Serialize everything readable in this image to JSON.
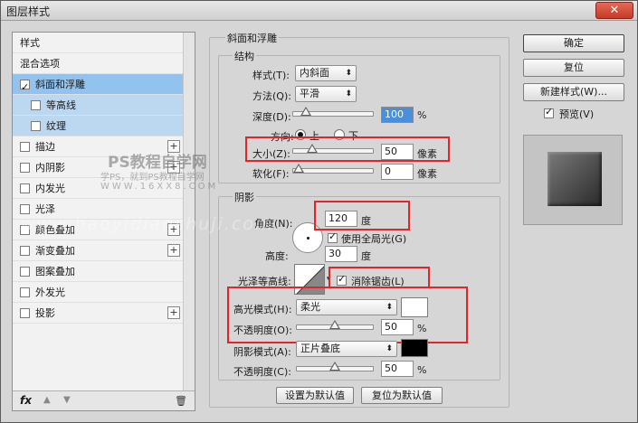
{
  "window": {
    "title": "图层样式",
    "close_glyph": "✕"
  },
  "left_panel": {
    "items": [
      {
        "label": "样式",
        "checkbox": false,
        "checked": false,
        "plus": false,
        "state": "normal"
      },
      {
        "label": "混合选项",
        "checkbox": false,
        "checked": false,
        "plus": false,
        "state": "normal"
      },
      {
        "label": "斜面和浮雕",
        "checkbox": true,
        "checked": true,
        "plus": false,
        "state": "selected"
      },
      {
        "label": "等高线",
        "checkbox": true,
        "checked": false,
        "plus": false,
        "state": "sub"
      },
      {
        "label": "纹理",
        "checkbox": true,
        "checked": false,
        "plus": false,
        "state": "sub"
      },
      {
        "label": "描边",
        "checkbox": true,
        "checked": false,
        "plus": true,
        "state": "normal"
      },
      {
        "label": "内阴影",
        "checkbox": true,
        "checked": false,
        "plus": true,
        "state": "normal"
      },
      {
        "label": "内发光",
        "checkbox": true,
        "checked": false,
        "plus": false,
        "state": "normal"
      },
      {
        "label": "光泽",
        "checkbox": true,
        "checked": false,
        "plus": false,
        "state": "normal"
      },
      {
        "label": "颜色叠加",
        "checkbox": true,
        "checked": false,
        "plus": true,
        "state": "normal"
      },
      {
        "label": "渐变叠加",
        "checkbox": true,
        "checked": false,
        "plus": true,
        "state": "normal"
      },
      {
        "label": "图案叠加",
        "checkbox": true,
        "checked": false,
        "plus": false,
        "state": "normal"
      },
      {
        "label": "外发光",
        "checkbox": true,
        "checked": false,
        "plus": false,
        "state": "normal"
      },
      {
        "label": "投影",
        "checkbox": true,
        "checked": false,
        "plus": true,
        "state": "normal"
      }
    ],
    "footer": {
      "fx": "fx",
      "up": "▲",
      "down": "▼",
      "trash": "🗑"
    }
  },
  "bevel": {
    "section_title": "斜面和浮雕",
    "structure_title": "结构",
    "style_label": "样式(T):",
    "style_value": "内斜面",
    "technique_label": "方法(Q):",
    "technique_value": "平滑",
    "depth_label": "深度(D):",
    "depth_value": "100",
    "depth_unit": "%",
    "depth_level": 0.1,
    "direction_label": "方向:",
    "direction_up": "上",
    "direction_down": "下",
    "size_label": "大小(Z):",
    "size_value": "50",
    "size_unit": "像素",
    "size_level": 0.2,
    "soften_label": "软化(F):",
    "soften_value": "0",
    "soften_unit": "像素",
    "soften_level": 0
  },
  "shading": {
    "title": "阴影",
    "angle_label": "角度(N):",
    "angle_value": "120",
    "angle_unit": "度",
    "global_light_label": "使用全局光(G)",
    "global_light_checked": true,
    "altitude_label": "高度:",
    "altitude_value": "30",
    "altitude_unit": "度",
    "gloss_contour_label": "光泽等高线:",
    "anti_alias_label": "消除锯齿(L)",
    "anti_alias_checked": true,
    "highlight_mode_label": "高光模式(H):",
    "highlight_mode_value": "柔光",
    "highlight_color": "#ffffff",
    "highlight_opacity_label": "不透明度(O):",
    "highlight_opacity_value": "50",
    "highlight_opacity_unit": "%",
    "highlight_opacity_level": 0.5,
    "shadow_mode_label": "阴影模式(A):",
    "shadow_mode_value": "正片叠底",
    "shadow_color": "#000000",
    "shadow_opacity_label": "不透明度(C):",
    "shadow_opacity_value": "50",
    "shadow_opacity_unit": "%",
    "shadow_opacity_level": 0.5
  },
  "bottom_buttons": {
    "make_default": "设置为默认值",
    "reset_default": "复位为默认值"
  },
  "right_panel": {
    "ok": "确定",
    "reset": "复位",
    "new_style": "新建样式(W)...",
    "preview_label": "预览(V)",
    "preview_checked": true
  },
  "watermark": {
    "line1": "PS教程自学网",
    "line2": "学PS，就到PS教程自学网",
    "line3": "WWW.16XX8.COM",
    "url": "www.haoyidianshuji.com"
  },
  "colors": {
    "highlight_red": "#e0252d",
    "selected_blue": "#92c3ee",
    "sub_blue": "#bcd8f1"
  }
}
